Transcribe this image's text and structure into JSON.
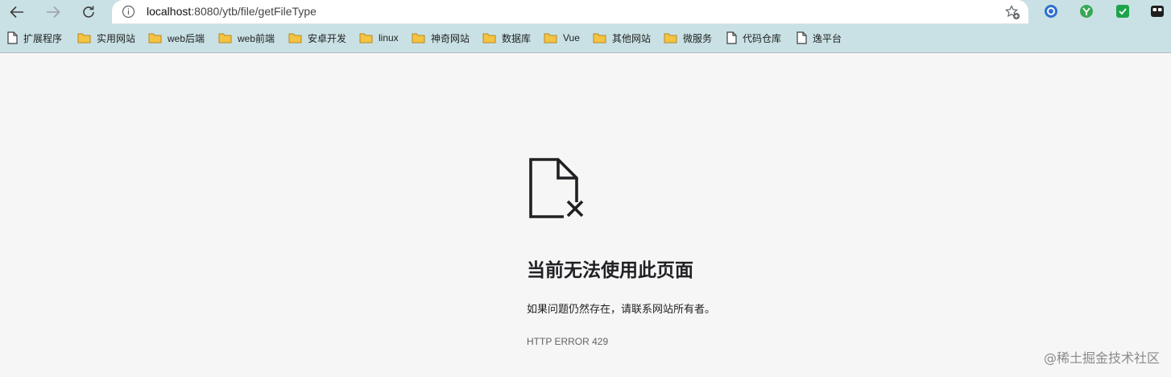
{
  "toolbar": {
    "back_icon": "arrow-left-icon",
    "forward_icon": "arrow-right-icon",
    "reload_icon": "reload-icon",
    "address": {
      "host": "localhost",
      "path": ":8080/ytb/file/getFileType",
      "info_icon": "info-icon",
      "star_icon": "star-add-icon"
    },
    "extensions": [
      "blue-circle-extension-icon",
      "green-circle-extension-icon",
      "green-shield-extension-icon",
      "dark-extension-icon"
    ]
  },
  "bookmarks": [
    {
      "label": "扩展程序",
      "icon": "page-icon"
    },
    {
      "label": "实用网站",
      "icon": "folder-icon"
    },
    {
      "label": "web后端",
      "icon": "folder-icon"
    },
    {
      "label": "web前端",
      "icon": "folder-icon"
    },
    {
      "label": "安卓开发",
      "icon": "folder-icon"
    },
    {
      "label": "linux",
      "icon": "folder-icon"
    },
    {
      "label": "神奇网站",
      "icon": "folder-icon"
    },
    {
      "label": "数据库",
      "icon": "folder-icon"
    },
    {
      "label": "Vue",
      "icon": "folder-icon"
    },
    {
      "label": "其他网站",
      "icon": "folder-icon"
    },
    {
      "label": "微服务",
      "icon": "folder-icon"
    },
    {
      "label": "代码仓库",
      "icon": "page-icon"
    },
    {
      "label": "逸平台",
      "icon": "page-icon"
    }
  ],
  "error": {
    "icon": "broken-file-icon",
    "title": "当前无法使用此页面",
    "description": "如果问题仍然存在，请联系网站所有者。",
    "code": "HTTP ERROR 429"
  },
  "watermark": "@稀土掘金技术社区",
  "colors": {
    "toolbar_bg": "#c9e1e4",
    "page_bg": "#f7f6f6",
    "folder_yellow": "#f5c342"
  }
}
